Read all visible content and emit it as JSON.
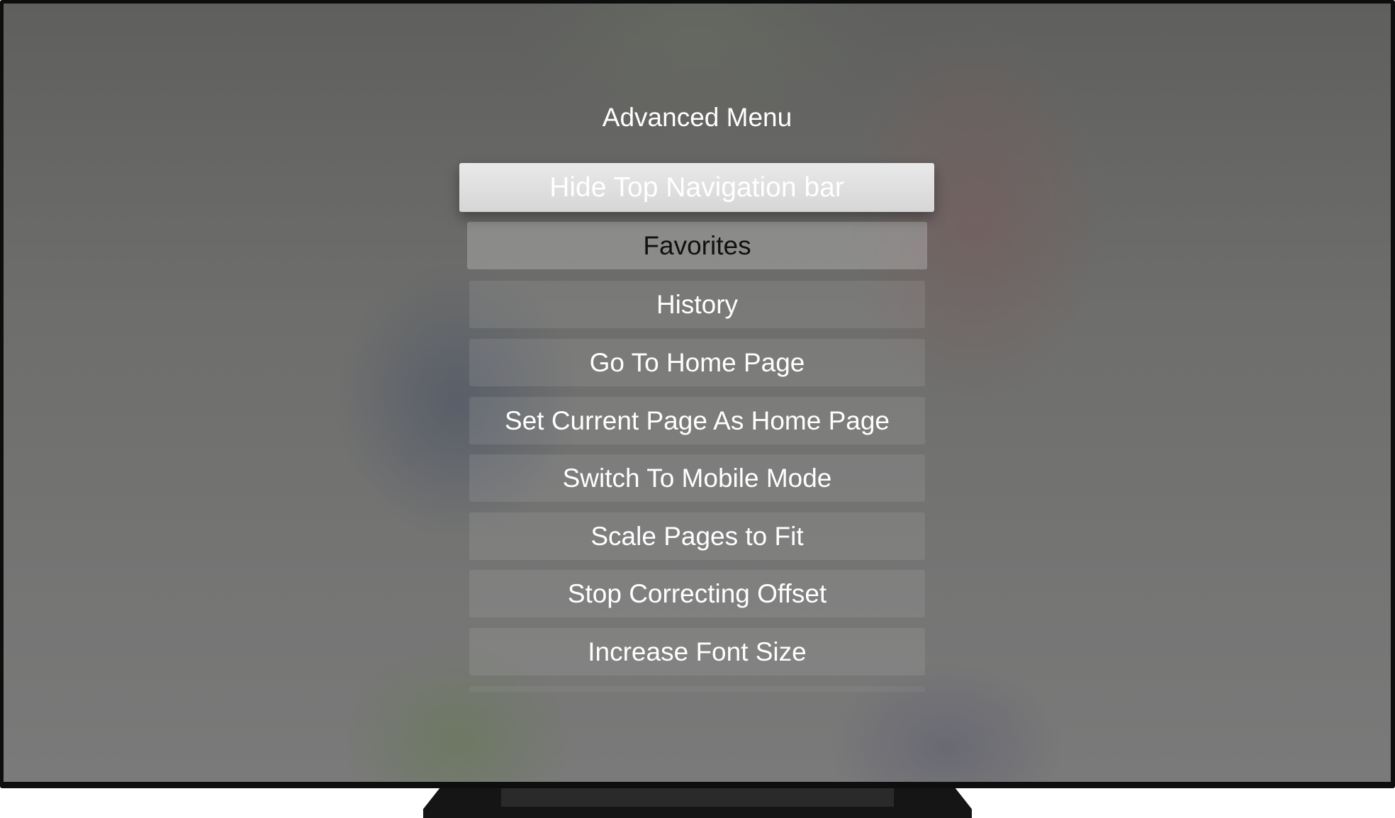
{
  "menu": {
    "title": "Advanced Menu",
    "items": [
      {
        "label": "Hide Top Navigation bar",
        "state": "focused"
      },
      {
        "label": "Favorites",
        "state": "secondary"
      },
      {
        "label": "History",
        "state": "normal"
      },
      {
        "label": "Go To Home Page",
        "state": "normal"
      },
      {
        "label": "Set Current Page As Home Page",
        "state": "normal"
      },
      {
        "label": "Switch To Mobile Mode",
        "state": "normal"
      },
      {
        "label": "Scale Pages to Fit",
        "state": "normal"
      },
      {
        "label": "Stop Correcting Offset",
        "state": "normal"
      },
      {
        "label": "Increase Font Size",
        "state": "normal"
      }
    ]
  }
}
